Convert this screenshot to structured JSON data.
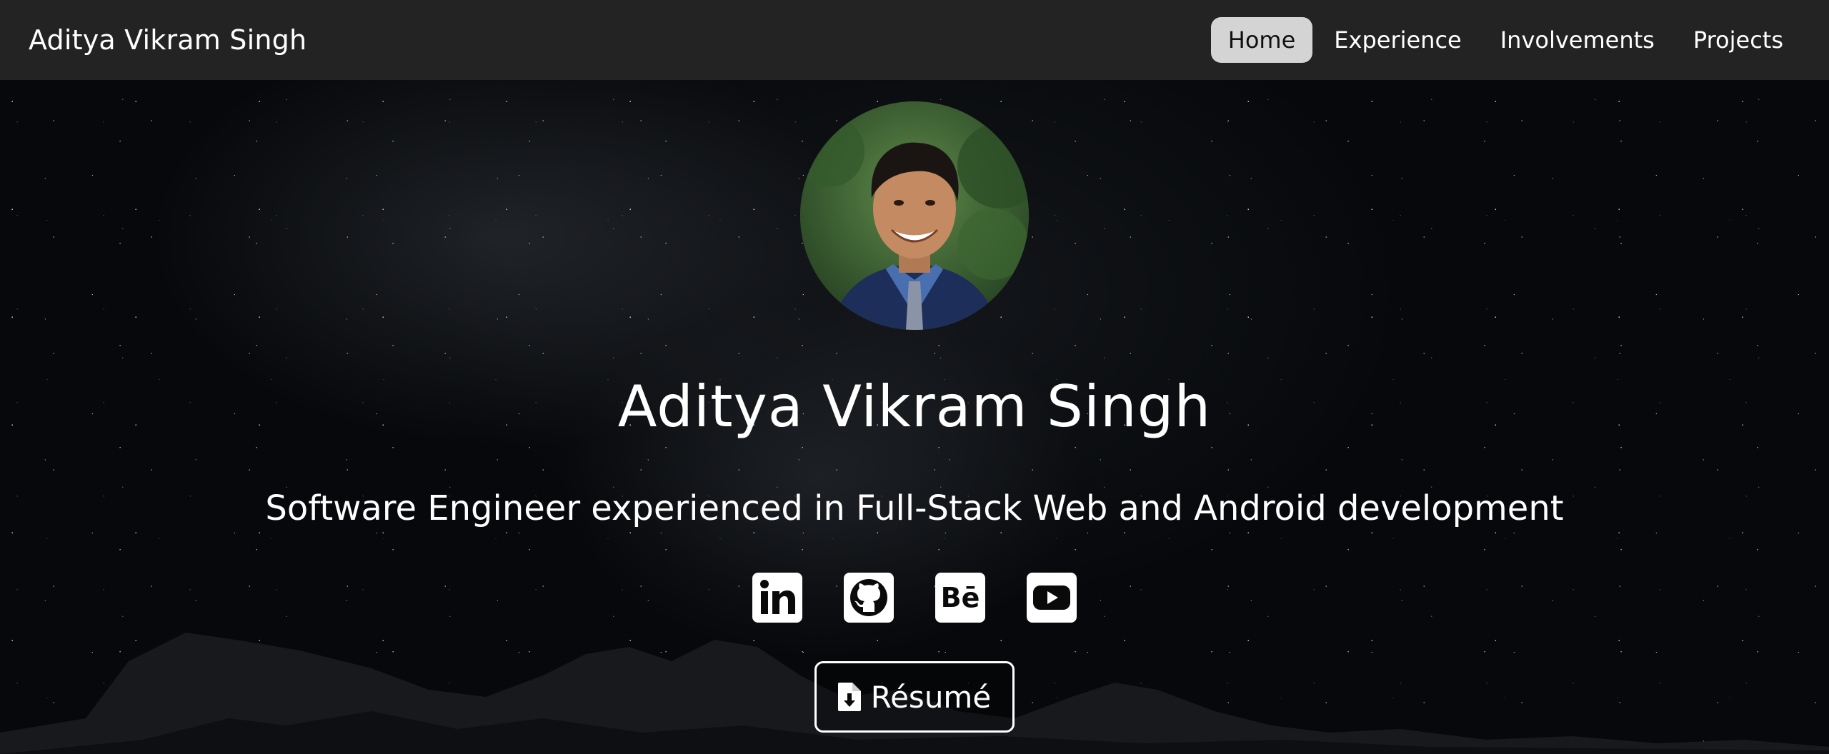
{
  "navbar": {
    "brand": "Aditya Vikram Singh",
    "links": [
      {
        "label": "Home",
        "active": true
      },
      {
        "label": "Experience",
        "active": false
      },
      {
        "label": "Involvements",
        "active": false
      },
      {
        "label": "Projects",
        "active": false
      }
    ]
  },
  "hero": {
    "name": "Aditya Vikram Singh",
    "tagline": "Software Engineer experienced in Full-Stack Web and Android development",
    "avatar_icon": "profile-photo",
    "socials": [
      {
        "icon": "linkedin-icon"
      },
      {
        "icon": "github-icon"
      },
      {
        "icon": "behance-icon",
        "glyph": "Bē"
      },
      {
        "icon": "youtube-icon"
      }
    ],
    "resume_label": "Résumé",
    "resume_icon": "file-download-icon"
  },
  "colors": {
    "navbar_bg": "#232323",
    "active_link_bg": "#d4d4d4",
    "hero_bg": "#06080b",
    "text": "#ffffff"
  }
}
